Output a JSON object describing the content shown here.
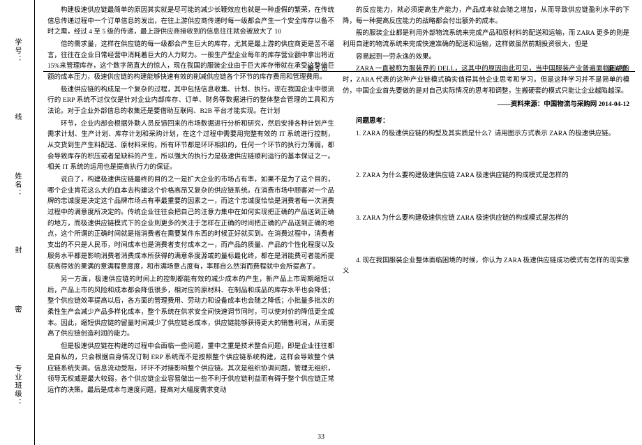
{
  "spine": {
    "class_label": "专业班级：",
    "name_label": "姓名：",
    "id_label": "学号：",
    "seal": "密   封   线"
  },
  "header": {
    "left": "第 5 页",
    "right": "第 6 页"
  },
  "col1": {
    "p1": "构建极速供应链最简单的原因其实就是尽可能的减少长鞭效应也就是一种虚假的繁荣，在传统信息传递过程中一个订单信息的发出，在往上游供应商传递时每一级都会产生一个安全库存以备不时之需，经过 4 至 5 级的传递，最上游供应商接收到的信息往往就会被放大了 10",
    "p2": "倍的需求量，这样在供应链的每一级都会产生巨大的库存，尤其是最上游的供应商更是苦不堪言，往往在企业日常经营中消耗着巨大的人力财力。一般生产型企业每年的库存营业额中拿出将近 15%来管理库存，这个数字简直大的惊人，现在我国的服装企业由于巨大库存带就在承受这整倍巨额的成本压力，极速供应链的构建能够快速有效的削减供应链各个环节的库存费用和管理费用。",
    "p3": "极速供应链的构成是一个复杂的过程，其中包括信息收集、计划、执行。现在我国企业中很流行的 ERP 系统不过仅仅是针对企业内部库存、订单、财务等数据进行的整体整合管理的工具和方法论。对于企业外部信息的收集还是要借助互联网、B2B 平台才能实现。在计划",
    "p4": "环节，企业内部会根据外勤人员反馈回来的市场数据进行分析和研究，然后安排各种计划产生需求计划、生产计划、库存计划和采购计划，在这个过程中需要用完整有效的 IT 系统进行控制，从交货到生产生料配送、原材料采购，所有环节都是环环相扣的，任何一个环节的执行力薄弱，都会导致库存的积压或者是缺料的产生，所以强大的执行力是极速供应链顺利运行的基本保证之一。相关 IT 系统的运用也是提高执行力的保证。",
    "p5": "说白了，构建极速供应链最终的目的之一是扩大企业的市场占有率，如果不是为了这个目的，哪个企业肯花这么大的血本去构建这个价格高昂又复杂的供应链系统。在消费市场中顾客对一个品牌的忠诚度是决定这个品牌市场占有率最重要的因素之一，而这个忠诚度恰恰是消费者每一次消费过程中的满意度所决定的。传统企业往往会把自己的注意力集中在如何实现把正确的产品送到正确的地方，而极速供应链模式下的企业则更多的关注于怎样在正确的时间把正确的产品送到正确的地点，这个所谓的正确时间就是指消费者在需要某件东西的时候正好就买到。在消费过程中，消费者支出的不只是人民币，时间成本也是消费者支付成本之一，而产品的质量、产品的个性化程度以及服务水平都是影响消费者消费成本所获得的满意条度源或的量标最化终，都在是消能费可者能所提获高得效的果满的意满程意度度，和市满场意占度有，率那自么然消而费程就中会所提高了。",
    "p6": "另一方面，极速供应链的时间上的控制都能有效的减少成本的产生，新产品上市周期缩短以后，产品上市的风险和成本都会降低很多，相对应的原材料、在制品和成品的库存水平也会降低；整个供应链效率提高以后，各方面的管理费用、劳动力和设备成本也会随之降低；小批量多批次的柔性生产会减少产品多样化成本，整个系统在供求安全间快速调节同时，可以使对价的降低更全成本。因此，缩短供应链的留量时间减少了供应链总成本，供应链能够获得更大的销售利润，从而提高了供应链创造利润的能力。",
    "p7": "但是极速供应链在构建的过程中会面临一些问题，重中之重是技术整合问题，即是企业往往都是自私的，只会根据自身情况订制 ERP 系统而不是按照整个供应链系统构建，这样会导致整个供应链系统失调。信息流动受阻，环环不对接影响整个供应链。其次是组织协调问题，管理无组织，领导无权威是最大较弱，各个供应链企业容易做出一些不利于供应链利益而有碍于整个供应链正常运作的决策。最后是成本与速度问题，提高对大幅度需求变动"
  },
  "col2": {
    "p1": "的反应能力，就必须提高生产能力，产品成本就会随之增加，从而导致供应链盈利水平的下降，每一种提高反应能力的战略都会付出额外的成本。",
    "p2": "般的服装企业都是利用外部物流系统来完成产品和原材料的配送和运输，而 ZARA 更多的则是利用自建的物流系统来完成快速准确的配送和运输，这样做虽然前期投资很大，但是",
    "p3": "容易起到一劳永逸的效果。",
    "p4": "ZARA 一直被称为服装界的 DELL，这其中的原因由此可见，当中国服装产业普遍面临困境的时，ZARA 代表的这种产业链模式确实值得其他企业思考和学习。但是这种学习并不是简单的模仿，中国企业首先要做的是对自己实际情况的思考和调整，生搬硬套的模式只能让企业越陷越深。",
    "source": "——资料来源：中国物流与采购网 2014-04-12",
    "heading": "问题思考：",
    "q1": "1. ZARA 的极速供应链的构型及其实质是什么？请用图示方式表示 ZARA 的极速供应链。",
    "q2": "2. ZARA 为什么要构建极速供应链 ZARA 极速供应链的构成模式是怎样的",
    "q3": "3. ZARA 为什么要构建极速供应链 ZARA 极速供应链的构成模式是怎样的",
    "q4": "4. 现在我国服装企业整体面临困境的时候，你认为 ZARA 极速供应链成功模式有怎样的现实意义"
  },
  "footer": {
    "page_num": "33"
  }
}
